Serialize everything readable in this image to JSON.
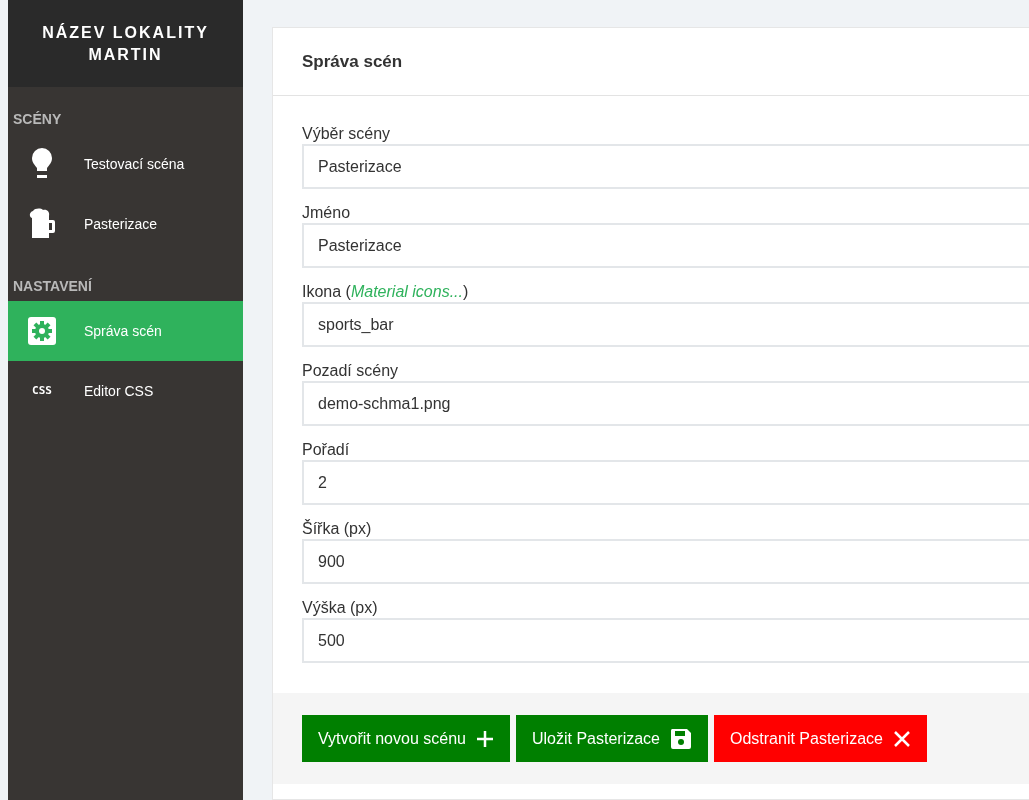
{
  "sidebar": {
    "title_lines": [
      "NÁZEV LOKALITY",
      "MARTIN"
    ],
    "sections": [
      {
        "heading": "SCÉNY",
        "items": [
          {
            "label": "Testovací scéna",
            "kind": "bulb",
            "selected": false
          },
          {
            "label": "Pasterizace",
            "kind": "mug",
            "selected": false
          }
        ]
      },
      {
        "heading": "NASTAVENÍ",
        "items": [
          {
            "label": "Správa scén",
            "kind": "gear",
            "selected": true
          },
          {
            "label": "Editor CSS",
            "kind": "css",
            "icon_text": "CSS",
            "selected": false
          }
        ]
      }
    ]
  },
  "card": {
    "title": "Správa scén",
    "fields": [
      {
        "label": "Výběr scény",
        "value": "Pasterizace"
      },
      {
        "label": "Jméno",
        "value": "Pasterizace"
      },
      {
        "label": "Ikona (",
        "link": "Material icons...",
        "label_after": ")",
        "value": "sports_bar"
      },
      {
        "label": "Pozadí scény",
        "value": "demo-schma1.png"
      },
      {
        "label": "Pořadí",
        "value": "2"
      },
      {
        "label": "Šířka (px)",
        "value": "900"
      },
      {
        "label": "Výška (px)",
        "value": "500"
      }
    ],
    "buttons": [
      {
        "label": "Vytvořit novou scénu",
        "kind": "create"
      },
      {
        "label": "Uložit Pasterizace",
        "kind": "save"
      },
      {
        "label": "Odstranit Pasterizace",
        "kind": "delete"
      }
    ]
  }
}
